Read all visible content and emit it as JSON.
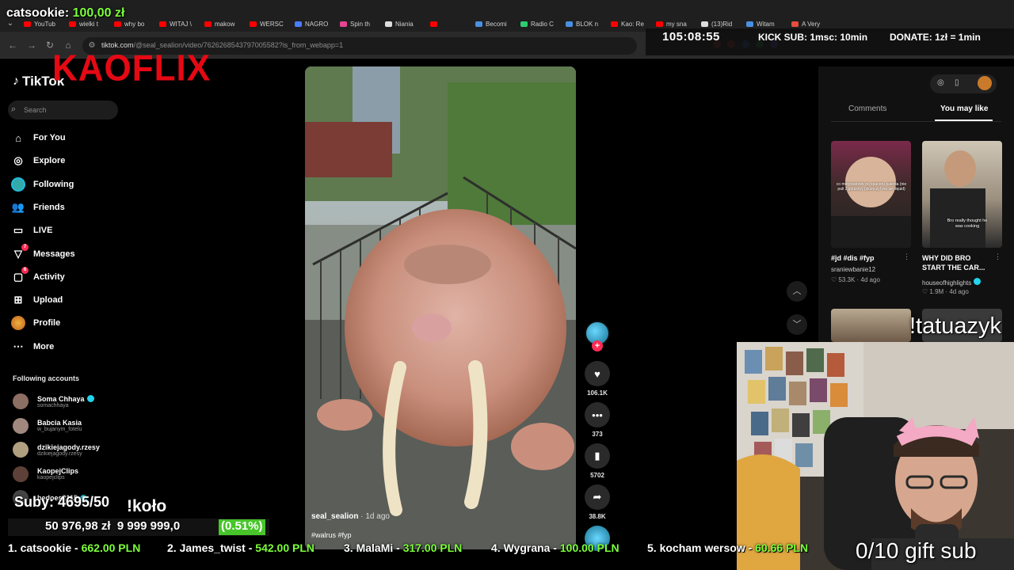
{
  "browser": {
    "tabs": [
      {
        "label": "YouTub",
        "color": "#ff0000"
      },
      {
        "label": "wielki t",
        "color": "#ff0000"
      },
      {
        "label": "why bo",
        "color": "#ff0000"
      },
      {
        "label": "WITAJ \\",
        "color": "#ff0000"
      },
      {
        "label": "makow",
        "color": "#ff0000"
      },
      {
        "label": "WERSC",
        "color": "#ff0000"
      },
      {
        "label": "NAGRO",
        "color": "#4a7cff"
      },
      {
        "label": "Spin th",
        "color": "#e84393"
      },
      {
        "label": "Niania",
        "color": "#dddddd"
      },
      {
        "label": "",
        "color": "#ff0000"
      },
      {
        "label": "Becomi",
        "color": "#4a90e2"
      },
      {
        "label": "Radio C",
        "color": "#2ecc71"
      },
      {
        "label": "BLOK n",
        "color": "#4a90e2"
      },
      {
        "label": "Kao: Re",
        "color": "#ff0000"
      },
      {
        "label": "my sna",
        "color": "#ff0000"
      },
      {
        "label": "(13)Rid",
        "color": "#dddddd"
      },
      {
        "label": "Witam",
        "color": "#4a90e2"
      },
      {
        "label": "A Very",
        "color": "#e74c3c"
      }
    ],
    "url_host": "tiktok.com",
    "url_path": "/@seal_sealion/video/7626268543797005582?is_from_webapp=1"
  },
  "overlay": {
    "top_donor_name": "catsookie:",
    "top_donor_amount": "100,00 zł",
    "timer": "105:08:55",
    "kick_sub": "KICK SUB: 1msc: 10min",
    "donate": "DONATE: 1zł = 1min",
    "brand": "KAOFLIX",
    "tatuazyk": "!tatuazyk",
    "gift_sub": "0/10 gift sub",
    "subs": "Suby: 4695/50",
    "kolo": "!koło",
    "goal_current": "50 976,98 zł",
    "goal_target": "9 999 999,0",
    "goal_percent": "(0.51%)",
    "ticker": [
      {
        "rank": "1. catsookie - ",
        "amount": "662.00 PLN"
      },
      {
        "rank": "2. James_twist - ",
        "amount": "542.00 PLN"
      },
      {
        "rank": "3. MalaMi - ",
        "amount": "317.00 PLN"
      },
      {
        "rank": "4. Wygrana - ",
        "amount": "100.00 PLN"
      },
      {
        "rank": "5. kocham wersow - ",
        "amount": "60.66 PLN"
      }
    ]
  },
  "tiktok": {
    "logo": "TikTok",
    "search_placeholder": "Search",
    "nav": [
      {
        "label": "For You",
        "icon": "home-icon"
      },
      {
        "label": "Explore",
        "icon": "compass-icon"
      },
      {
        "label": "Following",
        "icon": "following-avatar"
      },
      {
        "label": "Friends",
        "icon": "friends-icon"
      },
      {
        "label": "LIVE",
        "icon": "live-icon"
      },
      {
        "label": "Messages",
        "icon": "messages-icon",
        "badge": "7"
      },
      {
        "label": "Activity",
        "icon": "activity-icon",
        "badge": "6"
      },
      {
        "label": "Upload",
        "icon": "upload-icon"
      },
      {
        "label": "Profile",
        "icon": "profile-avatar"
      },
      {
        "label": "More",
        "icon": "more-icon"
      }
    ],
    "following_title": "Following accounts",
    "accounts": [
      {
        "name": "Soma Chhaya",
        "handle": "somachhaya",
        "verified": true,
        "color": "#8d6e63"
      },
      {
        "name": "Babcia Kasia",
        "handle": "w_bujanym_fotelu",
        "verified": false,
        "color": "#a1887f"
      },
      {
        "name": "dzikiejagody.rzesy",
        "handle": "dzikiejagody.rzesy",
        "verified": false,
        "color": "#b0a080"
      },
      {
        "name": "KaopejClips",
        "handle": "kaopejclips",
        "verified": false,
        "color": "#5d4037"
      },
      {
        "name": "bedoes2115",
        "handle": "",
        "verified": true,
        "color": "#444"
      }
    ],
    "video": {
      "author": "seal_sealion",
      "ago": " · 1d ago",
      "tags": "#walrus #fyp"
    },
    "actions": {
      "likes": "106.1K",
      "comments": "373",
      "saves": "5702",
      "shares": "38.8K"
    },
    "panel": {
      "tab_comments": "Comments",
      "tab_you_may_like": "You may like",
      "cards": [
        {
          "title": "#jd #dis #fyp",
          "user": "sraniewbanie12",
          "likes": "53.3K",
          "ago": "4d ago",
          "overlay_text": "co motywatorek po spaceru palenia (nie pali 2 godziny) (skonczyl mu sie liquid)"
        },
        {
          "title": "WHY DID BRO START THE CAR...",
          "user": "houseofhighlights",
          "likes": "1.9M",
          "ago": "4d ago",
          "overlay_text": "Bro really thought he was cooking"
        }
      ]
    }
  }
}
